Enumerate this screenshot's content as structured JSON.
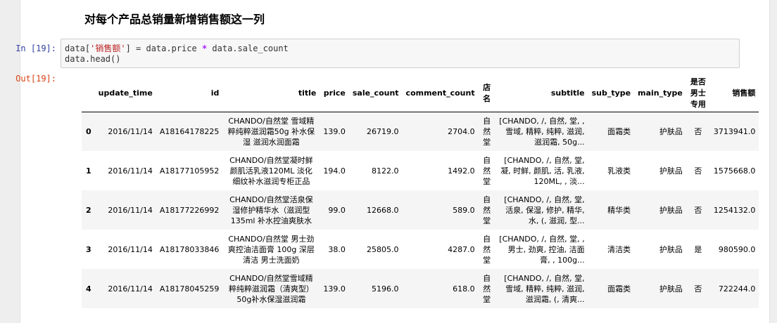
{
  "markdown_title": "对每个产品总销量新增销售额这一列",
  "input_prompt": "In  [19]:",
  "output_prompt": "Out[19]:",
  "code": {
    "line1_prefix": "data[",
    "line1_string": "'销售额'",
    "line1_mid": "] = data.price ",
    "line1_op": "*",
    "line1_suffix": " data.sale_count",
    "line2": "data.head()"
  },
  "table": {
    "columns": [
      "",
      "update_time",
      "id",
      "title",
      "price",
      "sale_count",
      "comment_count",
      "店名",
      "subtitle",
      "sub_type",
      "main_type",
      "是否男士专用",
      "销售额"
    ],
    "rows": [
      {
        "index": "0",
        "update_time": "2016/11/14",
        "id": "A18164178225",
        "title": "CHANDO/自然堂 雪域精粹纯粹滋润霜50g 补水保湿 滋润水润面霜",
        "price": "139.0",
        "sale_count": "26719.0",
        "comment_count": "2704.0",
        "shop": "自然堂",
        "subtitle": "[CHANDO, /, 自然, 堂, , 雪域, 精粹, 纯粹, 滋润, 滋润霜, 50g...",
        "sub_type": "面霜类",
        "main_type": "护肤品",
        "male": "否",
        "sales": "3713941.0"
      },
      {
        "index": "1",
        "update_time": "2016/11/14",
        "id": "A18177105952",
        "title": "CHANDO/自然堂凝时鲜颜肌活乳液120ML 淡化细纹补水滋润专柜正品",
        "price": "194.0",
        "sale_count": "8122.0",
        "comment_count": "1492.0",
        "shop": "自然堂",
        "subtitle": "[CHANDO, /, 自然, 堂, 凝, 时鲜, 颜肌, 活, 乳液, 120ML, , 淡...",
        "sub_type": "乳液类",
        "main_type": "护肤品",
        "male": "否",
        "sales": "1575668.0"
      },
      {
        "index": "2",
        "update_time": "2016/11/14",
        "id": "A18177226992",
        "title": "CHANDO/自然堂活泉保湿修护精华水（滋润型135ml 补水控油爽肤水",
        "price": "99.0",
        "sale_count": "12668.0",
        "comment_count": "589.0",
        "shop": "自然堂",
        "subtitle": "[CHANDO, /, 自然, 堂, 活泉, 保湿, 修护, 精华, 水, (, 滋润, 型...",
        "sub_type": "精华类",
        "main_type": "护肤品",
        "male": "否",
        "sales": "1254132.0"
      },
      {
        "index": "3",
        "update_time": "2016/11/14",
        "id": "A18178033846",
        "title": "CHANDO/自然堂 男士劲爽控油洁面膏 100g 深层清洁 男士洗面奶",
        "price": "38.0",
        "sale_count": "25805.0",
        "comment_count": "4287.0",
        "shop": "自然堂",
        "subtitle": "[CHANDO, /, 自然, 堂, , 男士, 劲爽, 控油, 洁面膏, , 100g...",
        "sub_type": "清洁类",
        "main_type": "护肤品",
        "male": "是",
        "sales": "980590.0"
      },
      {
        "index": "4",
        "update_time": "2016/11/14",
        "id": "A18178045259",
        "title": "CHANDO/自然堂雪域精粹纯粹滋润霜（清爽型）50g补水保湿滋润霜",
        "price": "139.0",
        "sale_count": "5196.0",
        "comment_count": "618.0",
        "shop": "自然堂",
        "subtitle": "[CHANDO, /, 自然, 堂, 雪域, 精粹, 纯粹, 滋润, 滋润霜, (, 清爽...",
        "sub_type": "面霜类",
        "main_type": "护肤品",
        "male": "否",
        "sales": "722244.0"
      }
    ]
  }
}
